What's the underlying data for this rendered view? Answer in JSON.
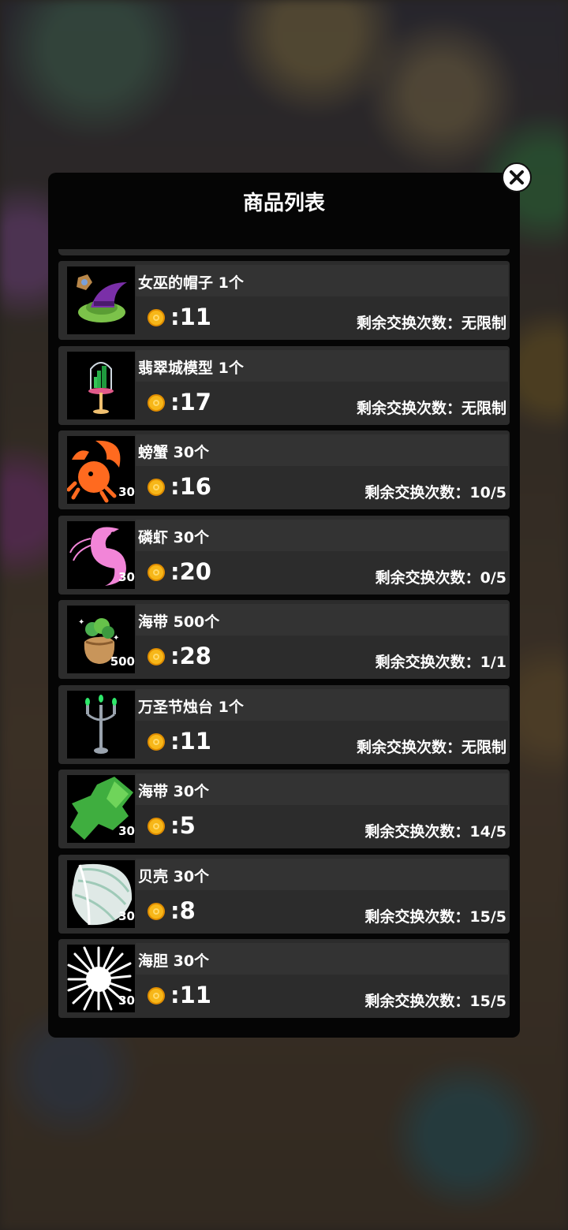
{
  "dialog": {
    "title": "商品列表"
  },
  "colors": {
    "panel": "#050505",
    "row": "#2c2c2c",
    "coin": "#f7b719"
  },
  "items": [
    {
      "name": "女巫的帽子 1个",
      "price": ":11",
      "limit": "剩余交换次数：无限制",
      "icon": "witch-hat-icon",
      "badge": ""
    },
    {
      "name": "翡翠城模型 1个",
      "price": ":17",
      "limit": "剩余交换次数：无限制",
      "icon": "emerald-city-model-icon",
      "badge": ""
    },
    {
      "name": "螃蟹 30个",
      "price": ":16",
      "limit": "剩余交换次数：10/5",
      "icon": "crab-icon",
      "badge": "30"
    },
    {
      "name": "磷虾 30个",
      "price": ":20",
      "limit": "剩余交换次数：0/5",
      "icon": "krill-icon",
      "badge": "30"
    },
    {
      "name": "海带 500个",
      "price": ":28",
      "limit": "剩余交换次数：1/1",
      "icon": "kelp-bag-icon",
      "badge": "500"
    },
    {
      "name": "万圣节烛台 1个",
      "price": ":11",
      "limit": "剩余交换次数：无限制",
      "icon": "candelabra-icon",
      "badge": ""
    },
    {
      "name": "海带 30个",
      "price": ":5",
      "limit": "剩余交换次数：14/5",
      "icon": "kelp-icon",
      "badge": "30"
    },
    {
      "name": "贝壳 30个",
      "price": ":8",
      "limit": "剩余交换次数：15/5",
      "icon": "shell-icon",
      "badge": "30"
    },
    {
      "name": "海胆 30个",
      "price": ":11",
      "limit": "剩余交换次数：15/5",
      "icon": "sea-urchin-icon",
      "badge": "30"
    }
  ]
}
